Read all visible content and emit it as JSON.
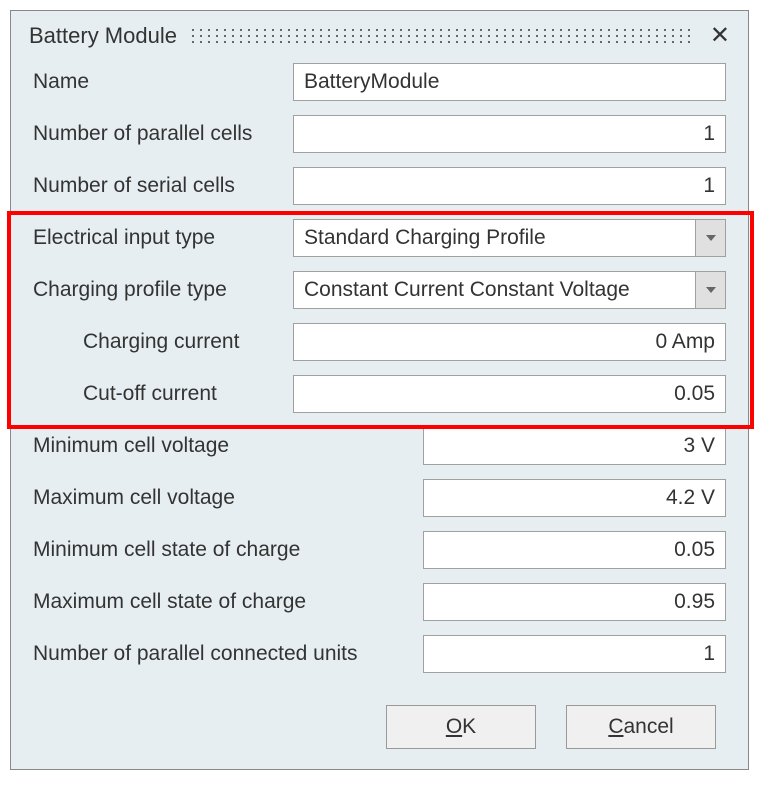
{
  "dialog": {
    "title": "Battery Module"
  },
  "fields": {
    "name": {
      "label": "Name",
      "value": "BatteryModule"
    },
    "parallel_cells": {
      "label": "Number of parallel cells",
      "value": "1"
    },
    "serial_cells": {
      "label": "Number of serial cells",
      "value": "1"
    },
    "electrical_input": {
      "label": "Electrical input type",
      "value": "Standard Charging Profile"
    },
    "profile_type": {
      "label": "Charging profile type",
      "value": "Constant Current Constant Voltage"
    },
    "charging_current": {
      "label": "Charging current",
      "value": "0 Amp"
    },
    "cutoff_current": {
      "label": "Cut-off current",
      "value": "0.05"
    },
    "min_voltage": {
      "label": "Minimum cell voltage",
      "value": "3 V"
    },
    "max_voltage": {
      "label": "Maximum cell voltage",
      "value": "4.2 V"
    },
    "min_soc": {
      "label": "Minimum cell state of charge",
      "value": "0.05"
    },
    "max_soc": {
      "label": "Maximum cell state of charge",
      "value": "0.95"
    },
    "parallel_units": {
      "label": "Number of parallel connected units",
      "value": "1"
    }
  },
  "buttons": {
    "ok_prefix": "O",
    "ok_rest": "K",
    "cancel_prefix": "C",
    "cancel_rest": "ancel"
  }
}
